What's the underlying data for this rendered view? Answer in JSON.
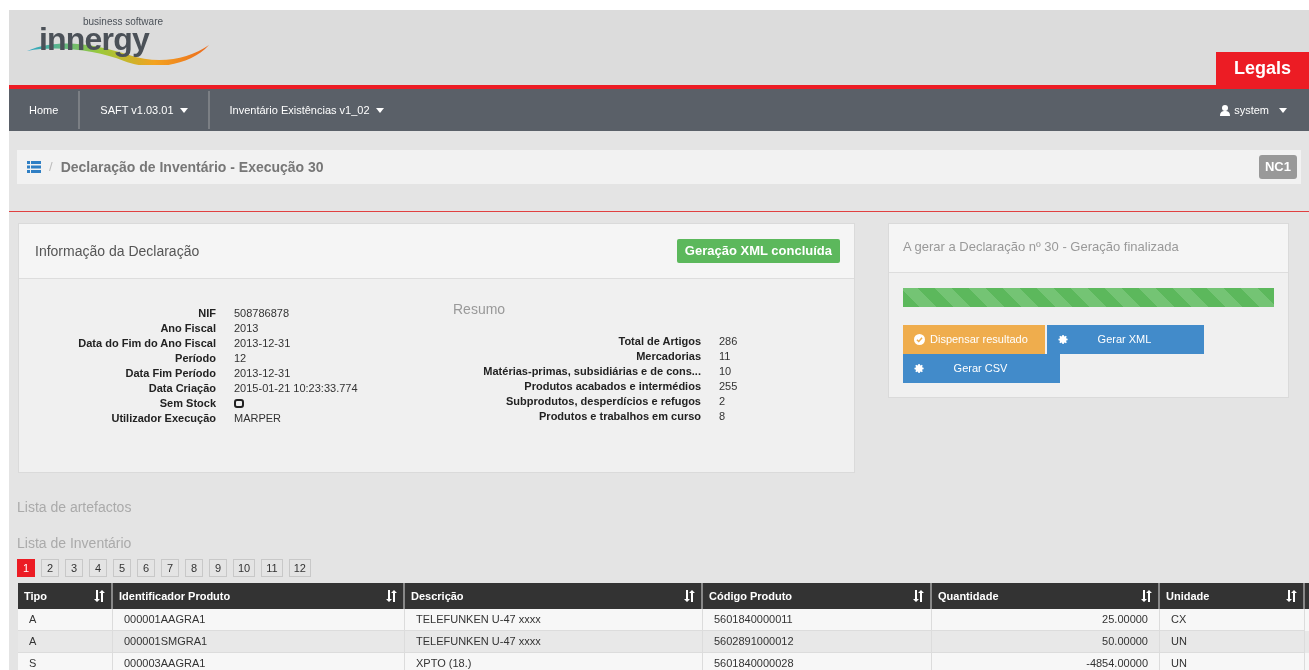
{
  "logo": {
    "tagline": "business software",
    "name": "innergy"
  },
  "brand_tab": "Legals",
  "nav": {
    "items": [
      {
        "label": "Home",
        "dropdown": false
      },
      {
        "label": "SAFT v1.03.01",
        "dropdown": true
      },
      {
        "label": "Inventário Existências v1_02",
        "dropdown": true
      }
    ],
    "user": "system"
  },
  "breadcrumb": {
    "separator": "/",
    "title": "Declaração de Inventário - Execução 30",
    "badge": "NC1"
  },
  "info_panel": {
    "title": "Informação da Declaração",
    "status": "Geração XML concluída",
    "fields": [
      {
        "label": "NIF",
        "value": "508786878",
        "kind": "text"
      },
      {
        "label": "Ano Fiscal",
        "value": "2013",
        "kind": "text"
      },
      {
        "label": "Data do Fim do Ano Fiscal",
        "value": "2013-12-31",
        "kind": "text"
      },
      {
        "label": "Período",
        "value": "12",
        "kind": "text"
      },
      {
        "label": "Data Fim Período",
        "value": "2013-12-31",
        "kind": "text"
      },
      {
        "label": "Data Criação",
        "value": "2015-01-21 10:23:33.774",
        "kind": "text"
      },
      {
        "label": "Sem Stock",
        "checked": false,
        "kind": "checkbox"
      },
      {
        "label": "Utilizador Execução",
        "value": "MARPER",
        "kind": "text"
      }
    ],
    "summary_title": "Resumo",
    "summary": [
      {
        "label": "Total de Artigos",
        "value": "286"
      },
      {
        "label": "Mercadorias",
        "value": "11"
      },
      {
        "label": "Matérias-primas, subsidiárias e de cons...",
        "value": "10"
      },
      {
        "label": "Produtos acabados e intermédios",
        "value": "255"
      },
      {
        "label": "Subprodutos, desperdícios e refugos",
        "value": "2"
      },
      {
        "label": "Produtos e trabalhos em curso",
        "value": "8"
      }
    ]
  },
  "progress_panel": {
    "title": "A gerar a Declaração nº 30 - Geração finalizada",
    "level": 1,
    "buttons": [
      {
        "label": "Dispensar resultado",
        "kind": "dismiss"
      },
      {
        "label": "Gerar XML",
        "kind": "generate"
      },
      {
        "label": "Gerar CSV",
        "kind": "generate"
      }
    ]
  },
  "artifacts_title": "Lista de artefactos",
  "inventory_title": "Lista de Inventário",
  "pages": [
    {
      "label": "1",
      "selected": true
    },
    {
      "label": "2",
      "selected": false
    },
    {
      "label": "3",
      "selected": false
    },
    {
      "label": "4",
      "selected": false
    },
    {
      "label": "5",
      "selected": false
    },
    {
      "label": "6",
      "selected": false
    },
    {
      "label": "7",
      "selected": false
    },
    {
      "label": "8",
      "selected": false
    },
    {
      "label": "9",
      "selected": false
    },
    {
      "label": "10",
      "selected": false
    },
    {
      "label": "11",
      "selected": false
    },
    {
      "label": "12",
      "selected": false
    }
  ],
  "table": {
    "columns": [
      "Tipo",
      "Identificador Produto",
      "Descrição",
      "Código Produto",
      "Quantidade",
      "Unidade"
    ],
    "rows": [
      [
        "A",
        "000001AAGRA1",
        "TELEFUNKEN U-47 xxxx",
        "5601840000011",
        "25.00000",
        "CX"
      ],
      [
        "A",
        "000001SMGRA1",
        "TELEFUNKEN U-47 xxxx",
        "5602891000012",
        "50.00000",
        "UN"
      ],
      [
        "S",
        "000003AAGRA1",
        "XPTO (18.)",
        "5601840000028",
        "-4854.00000",
        "UN"
      ]
    ]
  }
}
